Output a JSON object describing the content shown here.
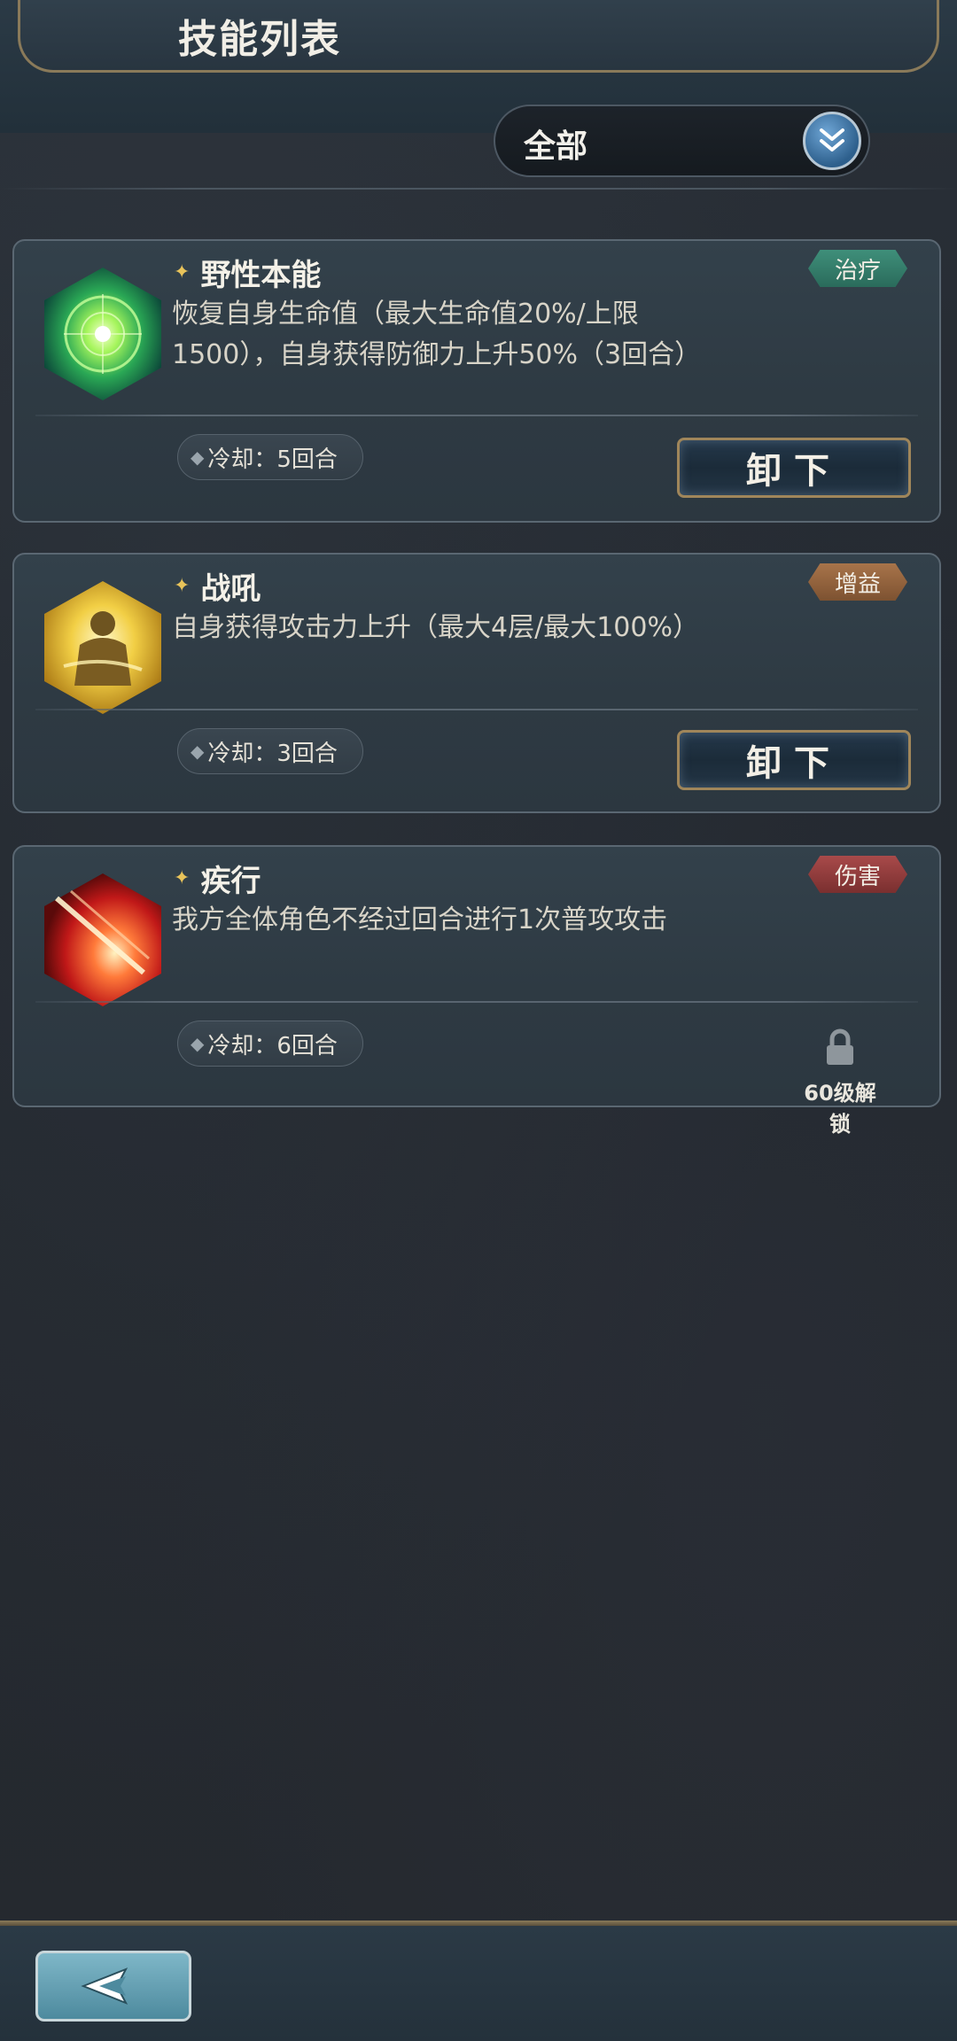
{
  "header": {
    "title": "技能列表"
  },
  "filter": {
    "label": "全部",
    "icon": "double-chevron-down-icon"
  },
  "skills": [
    {
      "name": "野性本能",
      "tag": "治疗",
      "tag_color": "#3f8f7a",
      "desc": "恢复自身生命值（最大生命值20%/上限1500），自身获得防御力上升50%（3回合）",
      "cooldown": "冷却：5回合",
      "action": "卸下",
      "icon": "green-orb-icon"
    },
    {
      "name": "战吼",
      "tag": "增益",
      "tag_color": "#a8744a",
      "desc": "自身获得攻击力上升（最大4层/最大100%）",
      "cooldown": "冷却：3回合",
      "action": "卸下",
      "icon": "golden-warrior-icon"
    },
    {
      "name": "疾行",
      "tag": "伤害",
      "tag_color": "#a84a4a",
      "desc": "我方全体角色不经过回合进行1次普攻攻击",
      "cooldown": "冷却：6回合",
      "locked_text": "60级解锁",
      "icon": "red-slash-icon"
    }
  ],
  "footer": {
    "back_icon": "back-arrow-icon"
  }
}
